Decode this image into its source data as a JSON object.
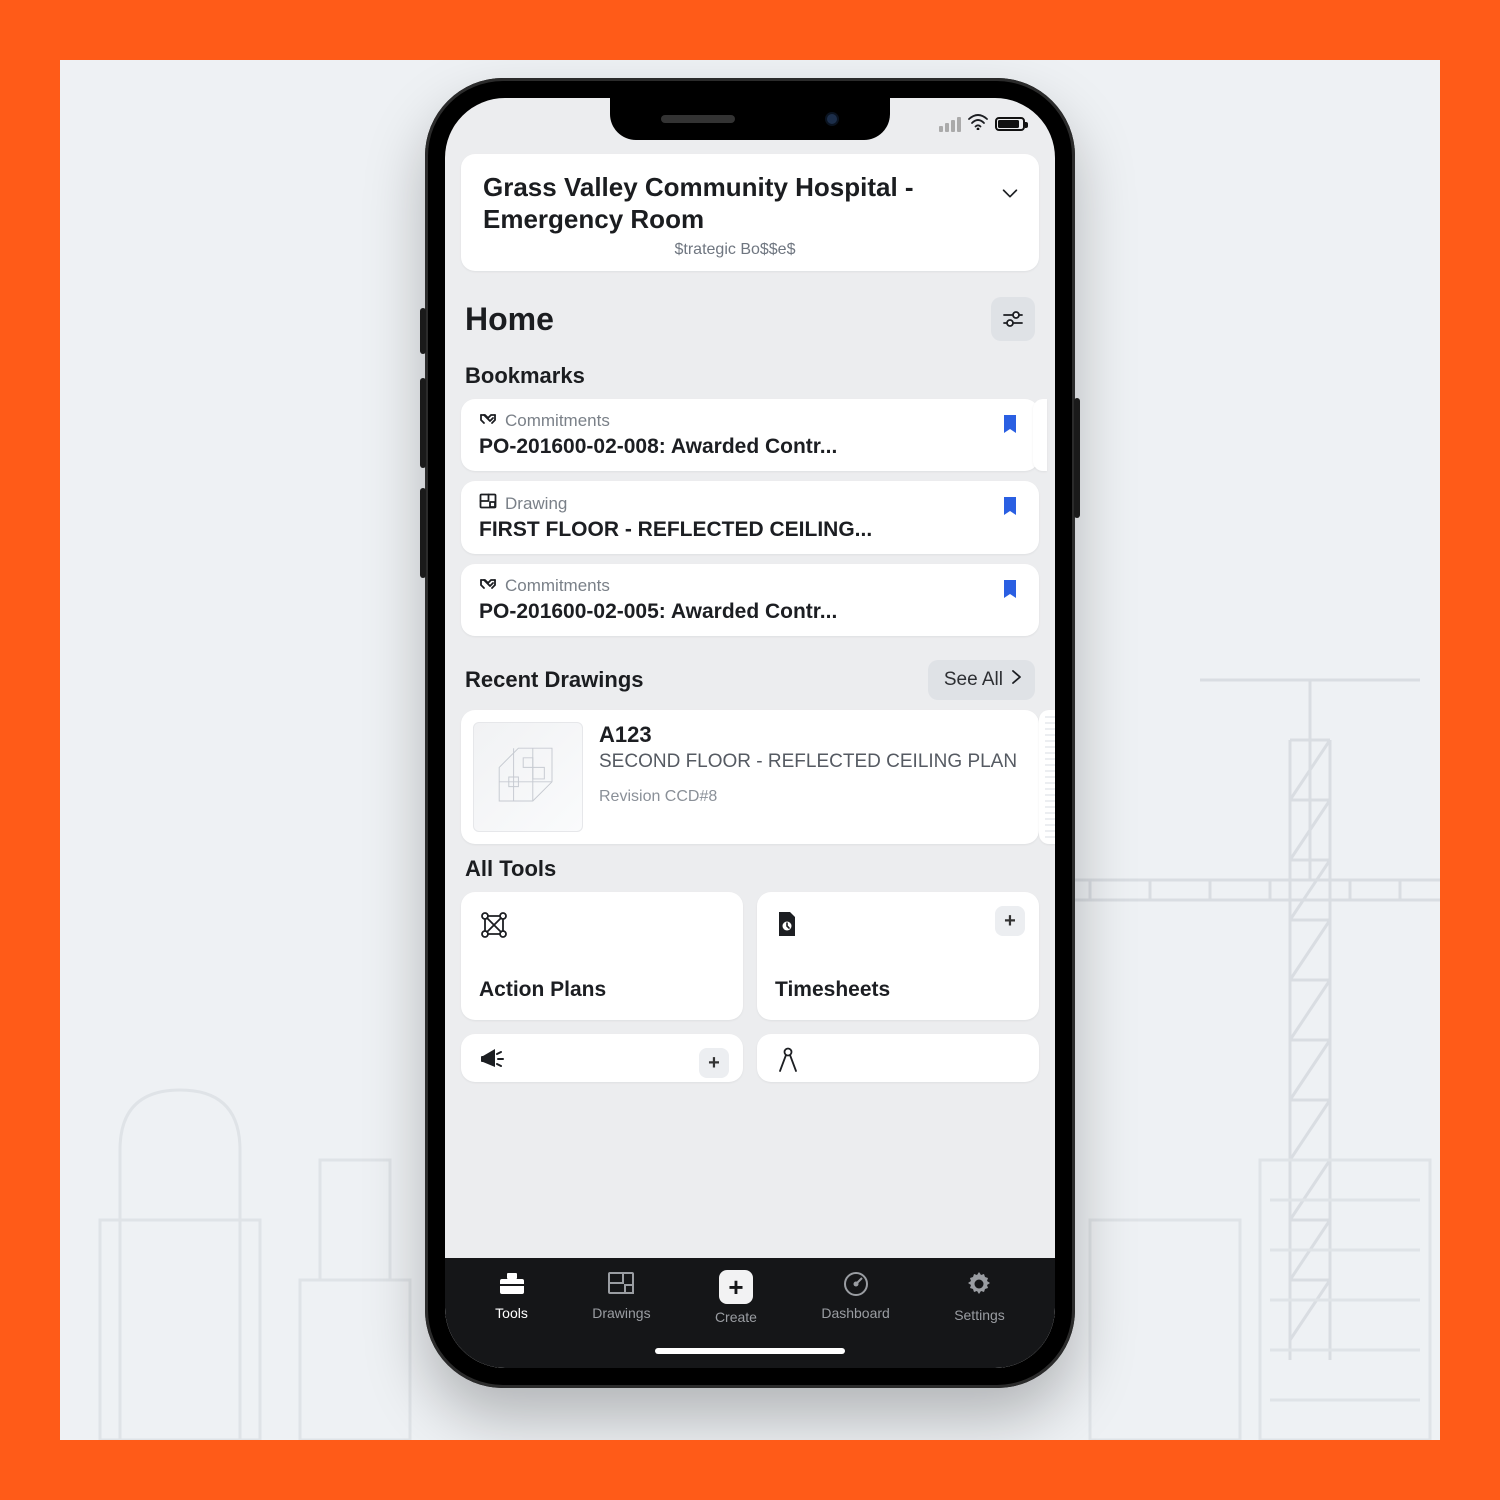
{
  "project": {
    "title": "Grass Valley Community Hospital - Emergency Room",
    "subtitle": "$trategic Bo$$e$"
  },
  "home": {
    "title": "Home"
  },
  "bookmarks": {
    "heading": "Bookmarks",
    "items": [
      {
        "category": "Commitments",
        "icon": "handshake-icon",
        "title": "PO-201600-02-008: Awarded Contr..."
      },
      {
        "category": "Drawing",
        "icon": "drawing-icon",
        "title": "FIRST FLOOR - REFLECTED CEILING..."
      },
      {
        "category": "Commitments",
        "icon": "handshake-icon",
        "title": "PO-201600-02-005: Awarded Contr..."
      }
    ]
  },
  "recent_drawings": {
    "heading": "Recent Drawings",
    "see_all_label": "See All",
    "items": [
      {
        "number": "A123",
        "desc": "SECOND FLOOR - REFLECTED CEILING PLAN",
        "revision": "Revision CCD#8"
      }
    ]
  },
  "all_tools": {
    "heading": "All Tools",
    "items": [
      {
        "name": "Action Plans",
        "icon": "nodes-icon",
        "has_plus": false
      },
      {
        "name": "Timesheets",
        "icon": "file-icon",
        "has_plus": true
      },
      {
        "name": "",
        "icon": "megaphone-icon",
        "has_plus": true
      },
      {
        "name": "",
        "icon": "droplet-icon",
        "has_plus": false
      }
    ]
  },
  "tabbar": {
    "items": [
      {
        "label": "Tools",
        "icon": "toolbox-icon",
        "active": true
      },
      {
        "label": "Drawings",
        "icon": "blueprint-icon",
        "active": false
      },
      {
        "label": "Create",
        "icon": "plus-icon",
        "active": false
      },
      {
        "label": "Dashboard",
        "icon": "gauge-icon",
        "active": false
      },
      {
        "label": "Settings",
        "icon": "gear-icon",
        "active": false
      }
    ]
  }
}
